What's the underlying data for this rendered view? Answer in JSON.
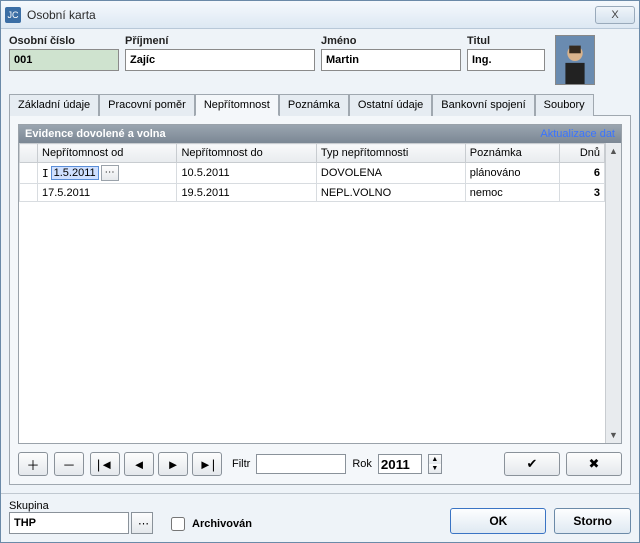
{
  "window": {
    "title": "Osobní karta"
  },
  "fields": {
    "osobni_cislo": {
      "label": "Osobní číslo",
      "value": "001"
    },
    "prijmeni": {
      "label": "Příjmení",
      "value": "Zajíc"
    },
    "jmeno": {
      "label": "Jméno",
      "value": "Martin"
    },
    "titul": {
      "label": "Titul",
      "value": "Ing."
    }
  },
  "tabs": {
    "items": [
      "Základní údaje",
      "Pracovní poměr",
      "Nepřítomnost",
      "Poznámka",
      "Ostatní údaje",
      "Bankovní spojení",
      "Soubory"
    ],
    "active_index": 2
  },
  "grid": {
    "title": "Evidence dovolené a volna",
    "refresh_link": "Aktualizace dat",
    "columns": [
      "Nepřítomnost od",
      "Nepřítomnost do",
      "Typ nepřítomnosti",
      "Poznámka",
      "Dnů"
    ],
    "rows": [
      {
        "od": "1.5.2011",
        "do": "10.5.2011",
        "typ": "DOVOLENA",
        "pozn": "plánováno",
        "dnu": "6",
        "editing": true
      },
      {
        "od": "17.5.2011",
        "do": "19.5.2011",
        "typ": "NEPL.VOLNO",
        "pozn": "nemoc",
        "dnu": "3",
        "editing": false
      }
    ]
  },
  "toolbar": {
    "filtr_label": "Filtr",
    "filtr_value": "",
    "rok_label": "Rok",
    "rok_value": "2011"
  },
  "bottom": {
    "skupina_label": "Skupina",
    "skupina_value": "THP",
    "archiv_label": "Archivován",
    "archiv_checked": false,
    "ok": "OK",
    "storno": "Storno"
  },
  "icons": {
    "plus": "＋",
    "minus": "－",
    "first": "|◄",
    "prev": "◄",
    "next": "►",
    "last": "►|",
    "check": "✔",
    "cross": "✖",
    "spin_up": "▲",
    "spin_down": "▼",
    "scroll_up": "▲",
    "scroll_down": "▼",
    "close": "X",
    "dots": "⋯"
  }
}
